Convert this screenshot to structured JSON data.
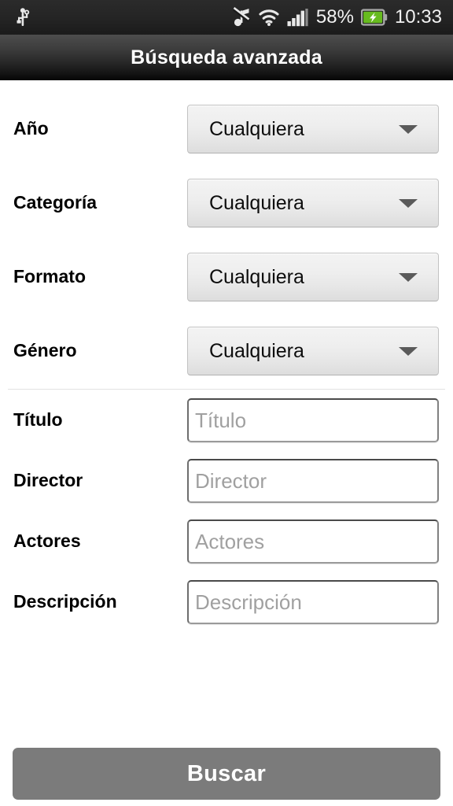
{
  "status_bar": {
    "usb_icon": "usb-icon",
    "mute_icon": "music-mute-icon",
    "wifi_icon": "wifi-icon",
    "signal_icon": "signal-bars-icon",
    "battery_percent": "58%",
    "battery_icon": "battery-charging-icon",
    "clock": "10:33",
    "background_color": "#242424",
    "text_color": "#f2f2f2",
    "battery_fill_color": "#67bb1f"
  },
  "title_bar": {
    "title": "Búsqueda avanzada",
    "text_color": "#ffffff"
  },
  "form": {
    "spinner_rows": [
      {
        "label": "Año",
        "value": "Cualquiera",
        "arrow_icon": "chevron-down-icon"
      },
      {
        "label": "Categoría",
        "value": "Cualquiera",
        "arrow_icon": "chevron-down-icon"
      },
      {
        "label": "Formato",
        "value": "Cualquiera",
        "arrow_icon": "chevron-down-icon"
      },
      {
        "label": "Género",
        "value": "Cualquiera",
        "arrow_icon": "chevron-down-icon"
      }
    ],
    "text_rows": [
      {
        "label": "Título",
        "placeholder": "Título",
        "value": ""
      },
      {
        "label": "Director",
        "placeholder": "Director",
        "value": ""
      },
      {
        "label": "Actores",
        "placeholder": "Actores",
        "value": ""
      },
      {
        "label": "Descripción",
        "placeholder": "Descripción",
        "value": ""
      }
    ],
    "label_color": "#000000",
    "spinner_text_color": "#0d0d0d",
    "placeholder_color": "#a0a0a0"
  },
  "search_button": {
    "label": "Buscar",
    "background_color": "#7b7b7b",
    "text_color": "#ffffff"
  }
}
